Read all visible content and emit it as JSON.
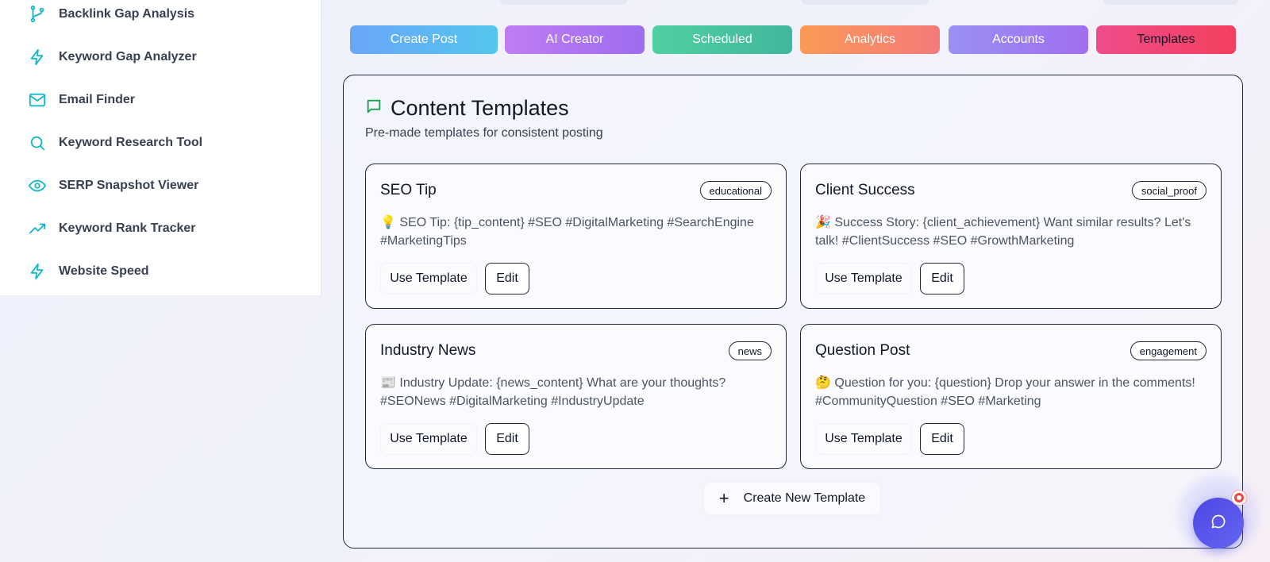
{
  "sidebar": {
    "items": [
      {
        "label": "Backlink Gap Analysis",
        "icon": "git-branch-icon"
      },
      {
        "label": "Keyword Gap Analyzer",
        "icon": "lightning-icon"
      },
      {
        "label": "Email Finder",
        "icon": "mail-icon"
      },
      {
        "label": "Keyword Research Tool",
        "icon": "search-icon"
      },
      {
        "label": "SERP Snapshot Viewer",
        "icon": "eye-icon"
      },
      {
        "label": "Keyword Rank Tracker",
        "icon": "trending-up-icon"
      },
      {
        "label": "Website Speed",
        "icon": "lightning-icon"
      }
    ],
    "icon_color": "#14b8c6"
  },
  "tabs": [
    {
      "label": "Create Post"
    },
    {
      "label": "AI Creator"
    },
    {
      "label": "Scheduled"
    },
    {
      "label": "Analytics"
    },
    {
      "label": "Accounts"
    },
    {
      "label": "Templates",
      "active": true
    }
  ],
  "panel": {
    "title": "Content Templates",
    "title_icon": "message-square-icon",
    "subtitle": "Pre-made templates for consistent posting",
    "templates": [
      {
        "name": "SEO Tip",
        "tag": "educational",
        "body": "💡 SEO Tip: {tip_content} #SEO #DigitalMarketing #SearchEngine #MarketingTips",
        "use_label": "Use Template",
        "edit_label": "Edit"
      },
      {
        "name": "Client Success",
        "tag": "social_proof",
        "body": "🎉 Success Story: {client_achievement} Want similar results? Let's talk! #ClientSuccess #SEO #GrowthMarketing",
        "use_label": "Use Template",
        "edit_label": "Edit"
      },
      {
        "name": "Industry News",
        "tag": "news",
        "body": "📰 Industry Update: {news_content} What are your thoughts? #SEONews #DigitalMarketing #IndustryUpdate",
        "use_label": "Use Template",
        "edit_label": "Edit"
      },
      {
        "name": "Question Post",
        "tag": "engagement",
        "body": "🤔 Question for you: {question} Drop your answer in the comments! #CommunityQuestion #SEO #Marketing",
        "use_label": "Use Template",
        "edit_label": "Edit"
      }
    ],
    "create_new_label": "Create New Template"
  },
  "chat": {
    "icon": "chat-bubble-icon",
    "notification": true,
    "accent": "#4f46e5"
  }
}
